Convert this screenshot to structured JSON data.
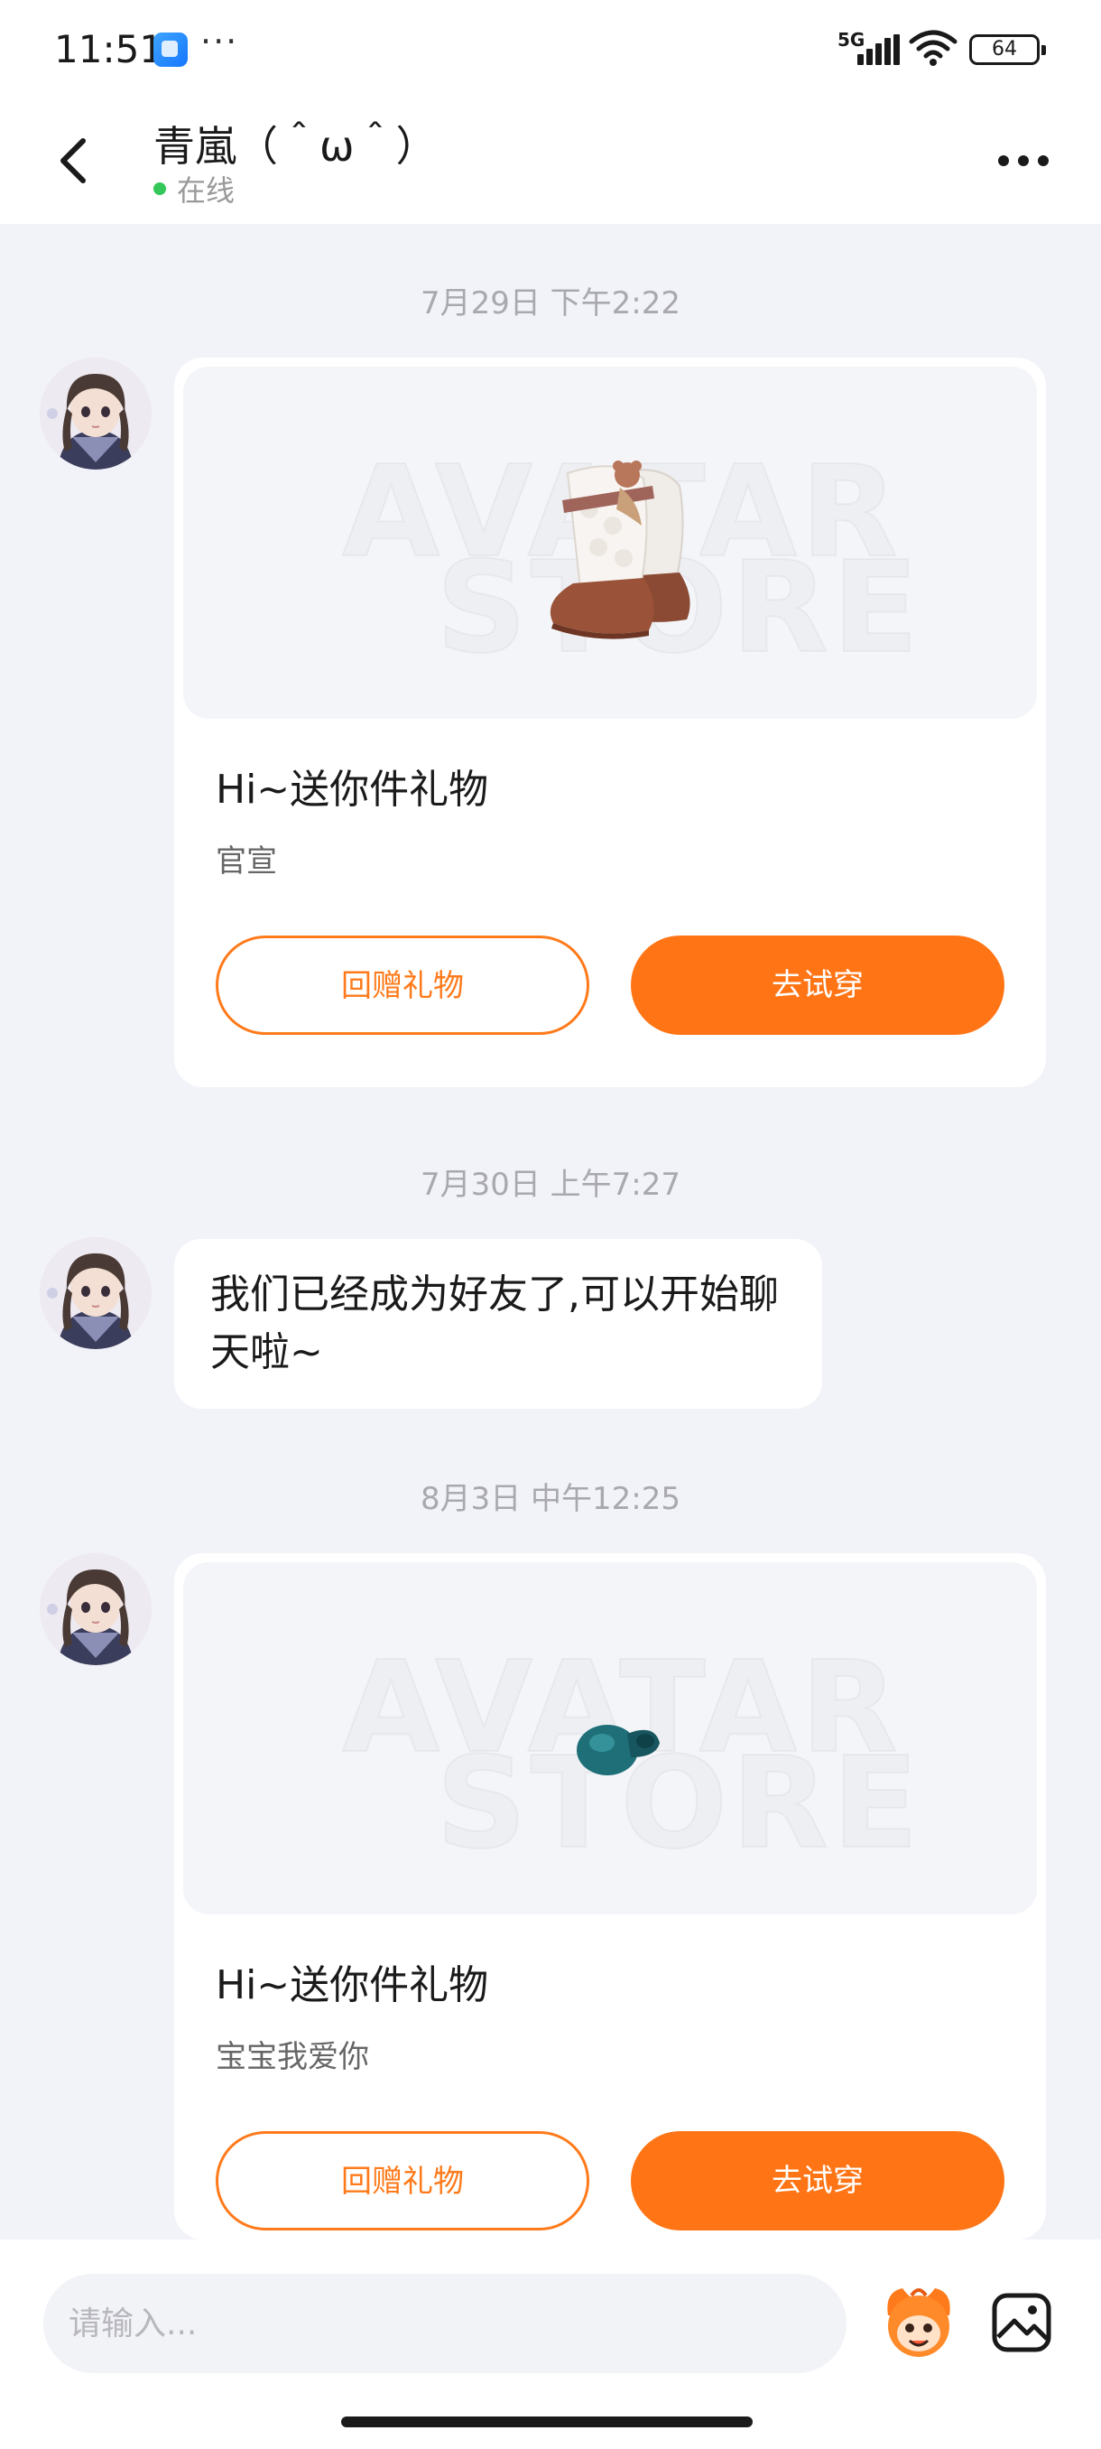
{
  "status_bar": {
    "time": "11:51",
    "dots": "···",
    "network": "5G",
    "battery": "64",
    "icons": [
      "app-icon",
      "signal-icon",
      "wifi-icon",
      "battery-icon"
    ]
  },
  "header": {
    "title": "青嵐（＾ω＾）",
    "status": "在线",
    "status_color": "#34c759",
    "icons": [
      "back-arrow-icon",
      "more-icon"
    ]
  },
  "messages": [
    {
      "timestamp": "7月29日 下午2:22",
      "type": "gift",
      "title": "Hi~送你件礼物",
      "subtitle": "官宣",
      "item": "boots",
      "watermark": [
        "AVATAR",
        "STORE"
      ],
      "return_gift_label": "回赠礼物",
      "try_on_label": "去试穿"
    },
    {
      "timestamp": "7月30日 上午7:27",
      "type": "text",
      "text": "我们已经成为好友了,可以开始聊天啦~"
    },
    {
      "timestamp": "8月3日 中午12:25",
      "type": "gift",
      "title": "Hi~送你件礼物",
      "subtitle": "宝宝我爱你",
      "item": "pacifier",
      "watermark": [
        "AVATAR",
        "STORE"
      ],
      "return_gift_label": "回赠礼物",
      "try_on_label": "去试穿"
    }
  ],
  "input_bar": {
    "placeholder": "请输入...",
    "icons": [
      "emoji-icon",
      "image-icon"
    ]
  },
  "colors": {
    "accent": "#ff7516",
    "background": "#f2f3f8",
    "card": "#ffffff"
  }
}
